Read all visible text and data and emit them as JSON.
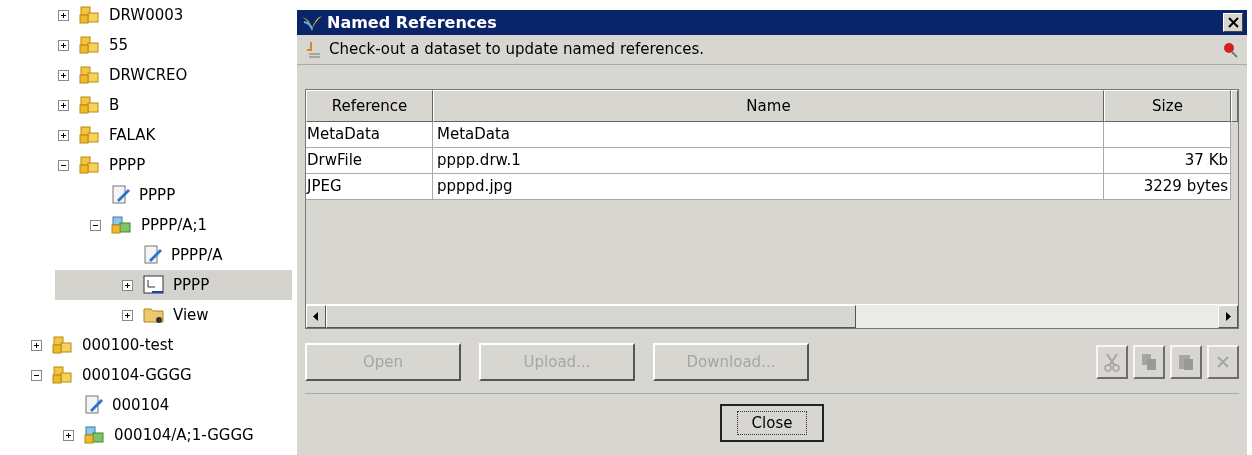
{
  "tree": {
    "partial_branch": [
      {
        "label": "DRW0003",
        "kind": "item",
        "expanded": false,
        "selected": false
      },
      {
        "label": "55",
        "kind": "item",
        "expanded": false,
        "selected": false
      },
      {
        "label": "DRWCREO",
        "kind": "item",
        "expanded": false,
        "selected": false
      },
      {
        "label": "B",
        "kind": "item",
        "expanded": false,
        "selected": false
      },
      {
        "label": "FALAK",
        "kind": "item",
        "expanded": false,
        "selected": false
      },
      {
        "label": "PPPP",
        "kind": "item",
        "expanded": true,
        "selected": false,
        "children": [
          {
            "label": "PPPP",
            "kind": "form",
            "selected": false
          },
          {
            "label": "PPPP/A;1",
            "kind": "revision",
            "expanded": true,
            "selected": false,
            "children": [
              {
                "label": "PPPP/A",
                "kind": "form",
                "selected": false
              },
              {
                "label": "PPPP",
                "kind": "drawing",
                "expanded": false,
                "selected": true
              },
              {
                "label": "View",
                "kind": "view",
                "expanded": false,
                "selected": false
              }
            ]
          }
        ]
      }
    ],
    "items": [
      {
        "label": "000100-test",
        "kind": "item",
        "expanded": false,
        "selected": false
      },
      {
        "label": "000104-GGGG",
        "kind": "item",
        "expanded": true,
        "selected": false,
        "children": [
          {
            "label": "000104",
            "kind": "form",
            "selected": false
          },
          {
            "label": "000104/A;1-GGGG",
            "kind": "revision",
            "expanded": false,
            "selected": false
          }
        ]
      }
    ]
  },
  "dialog": {
    "title": "Named References",
    "message": "Check-out a dataset to update named references.",
    "table": {
      "columns": [
        "Reference",
        "Name",
        "Size"
      ],
      "rows": [
        [
          "MetaData",
          "MetaData",
          ""
        ],
        [
          "DrwFile",
          "pppp.drw.1",
          "37 Kb"
        ],
        [
          "JPEG",
          "ppppd.jpg",
          "3229 bytes"
        ]
      ]
    },
    "buttons": [
      {
        "label": "Open",
        "disabled": true
      },
      {
        "label": "Upload...",
        "disabled": true
      },
      {
        "label": "Download...",
        "disabled": true
      }
    ],
    "tools": [
      {
        "kind": "cut",
        "disabled": true
      },
      {
        "kind": "copy",
        "disabled": true
      },
      {
        "kind": "paste",
        "disabled": true
      },
      {
        "kind": "delete",
        "disabled": true
      }
    ],
    "close_button": "Close"
  }
}
